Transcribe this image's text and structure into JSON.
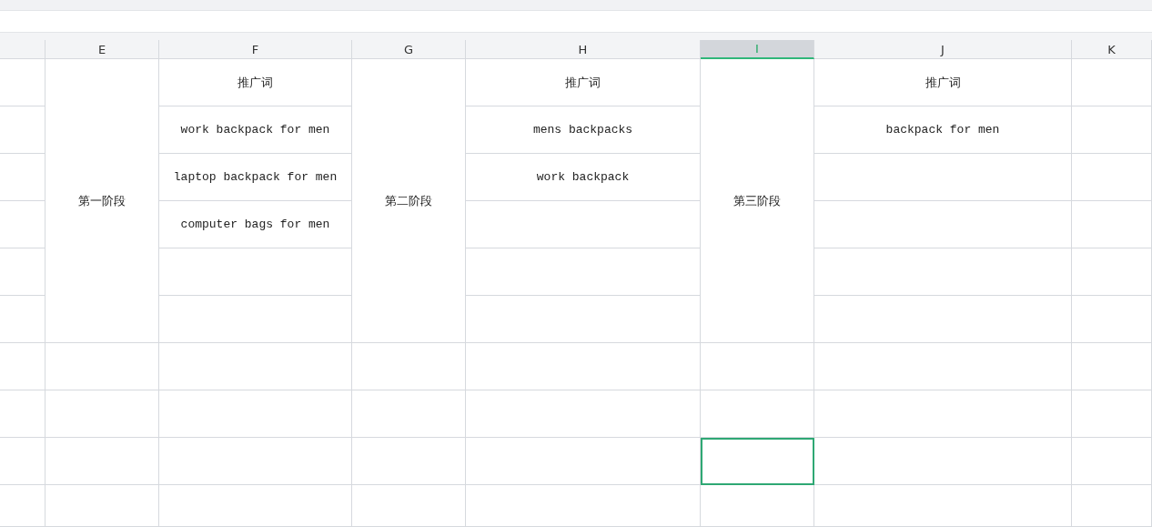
{
  "columns": [
    {
      "label": "E",
      "selected": false,
      "kind": "stage",
      "text": "第一阶段",
      "lower_cells": [
        {
          "selected": false
        },
        {
          "selected": false
        },
        {
          "selected": false
        },
        {
          "selected": false
        }
      ]
    },
    {
      "label": "F",
      "selected": false,
      "kind": "keywords",
      "cells": [
        {
          "text": "推广词",
          "selected": false
        },
        {
          "text": "work backpack for men",
          "selected": false
        },
        {
          "text": "laptop backpack for men",
          "selected": false
        },
        {
          "text": "computer bags for men",
          "selected": false
        },
        {
          "selected": false
        },
        {
          "selected": false
        },
        {
          "selected": false
        },
        {
          "selected": false
        },
        {
          "selected": false
        },
        {
          "selected": false
        }
      ]
    },
    {
      "label": "G",
      "selected": false,
      "kind": "stage",
      "text": "第二阶段",
      "lower_cells": [
        {
          "selected": false
        },
        {
          "selected": false
        },
        {
          "selected": false
        },
        {
          "selected": false
        }
      ]
    },
    {
      "label": "H",
      "selected": false,
      "kind": "keywords",
      "cells": [
        {
          "text": "推广词",
          "selected": false
        },
        {
          "text": "mens backpacks",
          "selected": false
        },
        {
          "text": "work backpack",
          "selected": false
        },
        {
          "selected": false
        },
        {
          "selected": false
        },
        {
          "selected": false
        },
        {
          "selected": false
        },
        {
          "selected": false
        },
        {
          "selected": false
        },
        {
          "selected": false
        }
      ]
    },
    {
      "label": "I",
      "selected": true,
      "kind": "stage",
      "text": "第三阶段",
      "lower_cells": [
        {
          "selected": false
        },
        {
          "selected": false
        },
        {
          "selected": true
        },
        {
          "selected": false
        }
      ]
    },
    {
      "label": "J",
      "selected": false,
      "kind": "keywords",
      "cells": [
        {
          "text": "推广词",
          "selected": false
        },
        {
          "text": "backpack for men",
          "selected": false
        },
        {
          "selected": false
        },
        {
          "selected": false
        },
        {
          "selected": false
        },
        {
          "selected": false
        },
        {
          "selected": false
        },
        {
          "selected": false
        },
        {
          "selected": false
        },
        {
          "selected": false
        }
      ]
    },
    {
      "label": "K",
      "selected": false,
      "kind": "keywords",
      "cells": [
        {
          "selected": false
        },
        {
          "selected": false
        },
        {
          "selected": false
        },
        {
          "selected": false
        },
        {
          "selected": false
        },
        {
          "selected": false
        },
        {
          "selected": false
        },
        {
          "selected": false
        },
        {
          "selected": false
        },
        {
          "selected": false
        }
      ]
    }
  ]
}
